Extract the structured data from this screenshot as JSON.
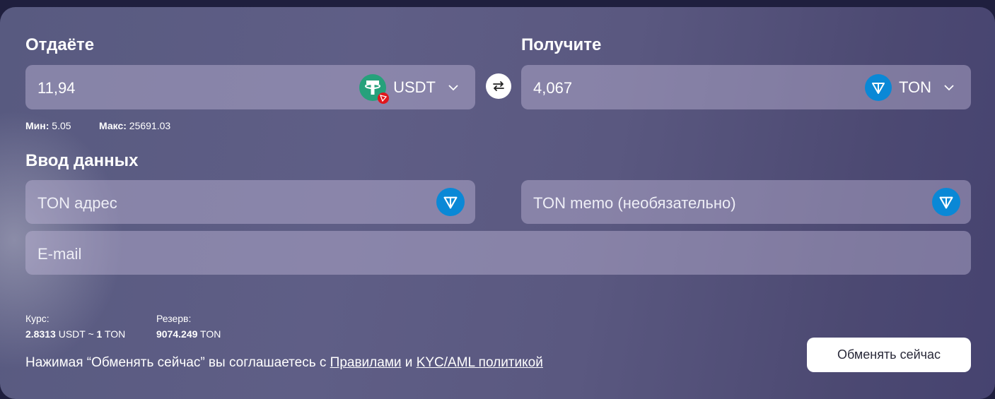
{
  "give": {
    "label": "Отдаёте",
    "amount": "11,94",
    "currency": "USDT",
    "currency_icon": "tether-usdt-icon",
    "min_label": "Мин:",
    "min_value": "5.05",
    "max_label": "Макс:",
    "max_value": "25691.03"
  },
  "receive": {
    "label": "Получите",
    "amount": "4,067",
    "currency": "TON",
    "currency_icon": "ton-icon"
  },
  "data_section": {
    "label": "Ввод данных",
    "address_placeholder": "TON адрес",
    "memo_placeholder": "TON memo (необязательно)",
    "email_placeholder": "E-mail"
  },
  "rate": {
    "label": "Курс:",
    "value_bold": "2.8313",
    "value_rest": "USDT ~",
    "value_bold2": "1",
    "value_unit": "TON"
  },
  "reserve": {
    "label": "Резерв:",
    "value_bold": "9074.249",
    "value_unit": "TON"
  },
  "agreement": {
    "prefix": "Нажимая “Обменять сейчас” вы соглашаетесь с",
    "rules_link": "Правилами",
    "and": "и",
    "policy_link": "KYC/AML политикой"
  },
  "submit_label": "Обменять сейчас",
  "colors": {
    "usdt": "#26a17b",
    "ton": "#0a88d6",
    "tron_badge": "#e0171c"
  }
}
